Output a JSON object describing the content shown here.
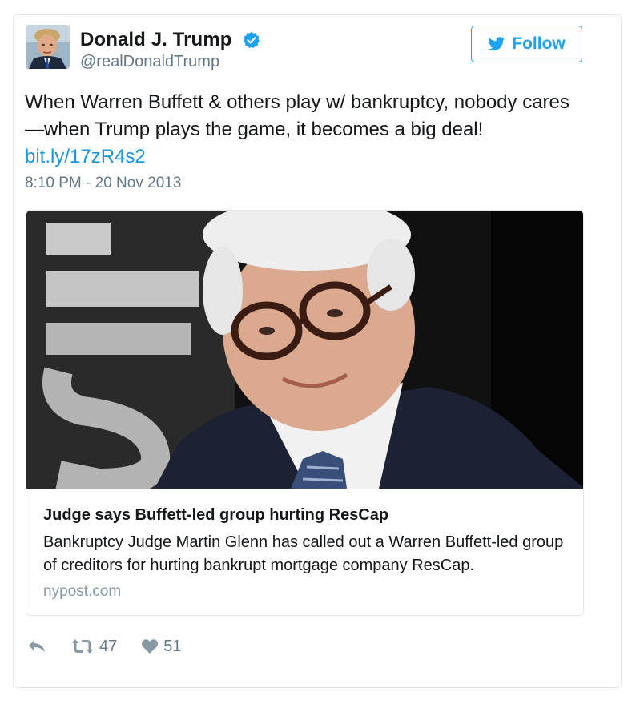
{
  "author": {
    "name": "Donald J. Trump",
    "handle": "@realDonaldTrump",
    "avatar_icon": "profile-photo",
    "verified_color": "#1da1f2"
  },
  "follow_button": {
    "label": "Follow",
    "icon": "twitter-bird-icon"
  },
  "tweet": {
    "text": "When Warren Buffett & others play w/ bankruptcy, nobody cares —when Trump plays the game, it becomes a big deal!",
    "link": "bit.ly/17zR4s2",
    "timestamp": "8:10 PM - 20 Nov 2013"
  },
  "card": {
    "image_icon": "photo-of-warren-buffett",
    "title": "Judge says Buffett-led group hurting ResCap",
    "description": "Bankruptcy Judge Martin Glenn has called out a Warren Buffett-led group of creditors for hurting bankrupt mortgage company ResCap.",
    "domain": "nypost.com"
  },
  "actions": {
    "reply_icon": "reply-icon",
    "retweet_icon": "retweet-icon",
    "retweet_count": "47",
    "like_icon": "heart-icon",
    "like_count": "51"
  },
  "colors": {
    "brand_blue": "#1da1f2",
    "link_blue": "#1b95e0",
    "secondary_text": "#657786",
    "border": "#e1e8ed"
  }
}
